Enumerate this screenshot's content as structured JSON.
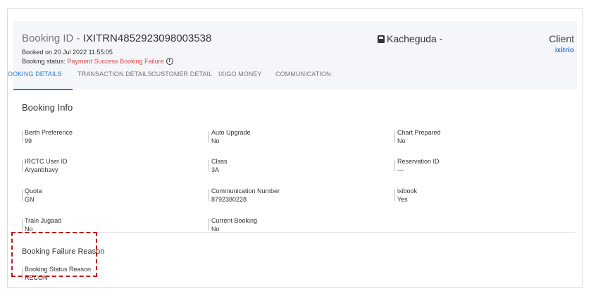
{
  "header": {
    "booking_id_label": "Booking ID - ",
    "booking_id": "IXITRN4852923098003538",
    "booked_on": "Booked on 20 Jul 2022 11:55:05",
    "status_label": "Booking status: ",
    "status_value": "Payment Success Booking Failure",
    "train_station": "Kacheguda -",
    "client_label": "Client",
    "client_value": "ixitrio"
  },
  "tabs": [
    {
      "label": "OOKING DETAILS"
    },
    {
      "label": "TRANSACTION DETAILS"
    },
    {
      "label": "CUSTOMER DETAIL"
    },
    {
      "label": "IXIGO MONEY"
    },
    {
      "label": "COMMUNICATION"
    }
  ],
  "booking_info": {
    "title": "Booking Info",
    "fields": [
      {
        "label": "Berth Preference",
        "value": "99"
      },
      {
        "label": "Auto Upgrade",
        "value": "No"
      },
      {
        "label": "Chart Prepared",
        "value": "No"
      },
      {
        "label": "IRCTC User ID",
        "value": "Aryanbhavy"
      },
      {
        "label": "Class",
        "value": "3A"
      },
      {
        "label": "Reservation ID",
        "value": "---"
      },
      {
        "label": "Quota",
        "value": "GN"
      },
      {
        "label": "Communication Number",
        "value": "8792380228"
      },
      {
        "label": "ixibook",
        "value": "Yes"
      },
      {
        "label": "Train Jugaad",
        "value": "No"
      },
      {
        "label": "Current Booking",
        "value": "No"
      }
    ]
  },
  "failure": {
    "title": "Booking Failure Reason",
    "label": "Booking Status Reason",
    "value": "RECON"
  },
  "colors": {
    "accent": "#2f7fd0",
    "status_error": "#e04a4a",
    "highlight": "#c0191f"
  }
}
